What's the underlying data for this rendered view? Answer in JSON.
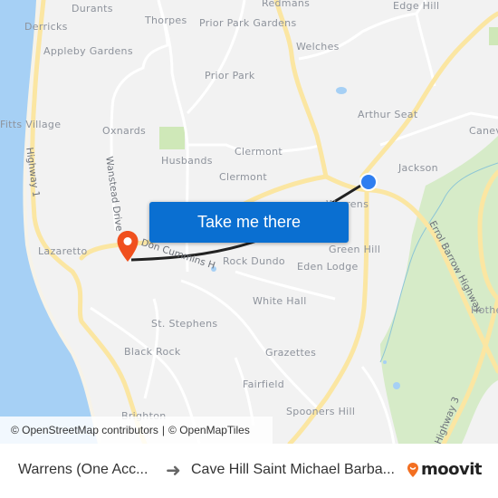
{
  "map": {
    "colors": {
      "land": "#f2f2f2",
      "water": "#a6d0f5",
      "major_road": "#fbe6a2",
      "minor_road": "#ffffff",
      "park": "#cfe8c0",
      "route_line": "#222222",
      "origin": "#2f7ef0",
      "destination": "#f0501e"
    },
    "places": [
      {
        "name": "Durants"
      },
      {
        "name": "Thorpes"
      },
      {
        "name": "Prior Park Gardens"
      },
      {
        "name": "Redmans"
      },
      {
        "name": "Edge Hill"
      },
      {
        "name": "Derricks"
      },
      {
        "name": "Appleby Gardens"
      },
      {
        "name": "Welches"
      },
      {
        "name": "Prior Park"
      },
      {
        "name": "Arthur Seat"
      },
      {
        "name": "Fitts Village"
      },
      {
        "name": "Oxnards"
      },
      {
        "name": "Canev"
      },
      {
        "name": "Clermont"
      },
      {
        "name": "Husbands"
      },
      {
        "name": "Jackson"
      },
      {
        "name": "Clermont"
      },
      {
        "name": "Warrens"
      },
      {
        "name": "Lazaretto"
      },
      {
        "name": "Green Hill"
      },
      {
        "name": "Rock Dundo"
      },
      {
        "name": "Eden Lodge"
      },
      {
        "name": "White Hall"
      },
      {
        "name": "St. Stephens"
      },
      {
        "name": "Hothe Turn"
      },
      {
        "name": "Black Rock"
      },
      {
        "name": "Grazettes"
      },
      {
        "name": "Fairfield"
      },
      {
        "name": "Spooners Hill"
      },
      {
        "name": "Brighton"
      }
    ],
    "roads": [
      {
        "name": "Highway 1"
      },
      {
        "name": "Wanstead Drive"
      },
      {
        "name": "Errol Barrow Highway"
      },
      {
        "name": "Highway 3"
      },
      {
        "name": "Don Cummins H"
      }
    ],
    "markers": {
      "origin": {
        "icon": "origin-dot-icon"
      },
      "destination": {
        "icon": "map-pin-icon"
      }
    }
  },
  "cta": {
    "label": "Take me there"
  },
  "attribution": {
    "osm": "© OpenStreetMap contributors",
    "separator": "|",
    "omt": "© OpenMapTiles"
  },
  "footer": {
    "from": "Warrens (One Acc...",
    "arrow_icon": "arrow-right-icon",
    "to": "Cave Hill Saint Michael Barba...",
    "brand": "moovit",
    "brand_color": "#f36f21"
  }
}
